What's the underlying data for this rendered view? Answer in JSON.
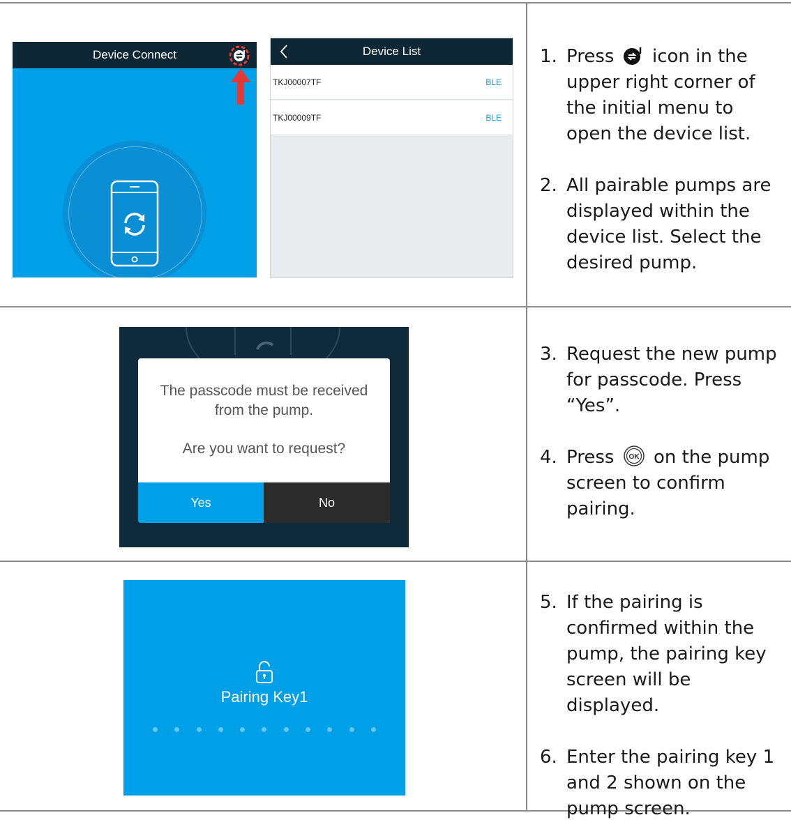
{
  "row1": {
    "connect_screen": {
      "title": "Device Connect"
    },
    "list_screen": {
      "title": "Device List",
      "devices": [
        {
          "name": "TKJ00007TF",
          "type": "BLE"
        },
        {
          "name": "TKJ00009TF",
          "type": "BLE"
        }
      ]
    },
    "steps": [
      {
        "num": "1.",
        "before_icon": "Press",
        "after_icon": "icon in the upper right corner of the initial menu to open the device list."
      },
      {
        "num": "2.",
        "text": "All pairable pumps are displayed within the device list.   Select the desired pump."
      }
    ]
  },
  "row2": {
    "dialog": {
      "message_line1": "The passcode must be received",
      "message_line2": "from the pump.",
      "question": "Are you want to request?",
      "yes_label": "Yes",
      "no_label": "No"
    },
    "steps": [
      {
        "num": "3.",
        "text": "Request the new pump for passcode. Press “Yes”."
      },
      {
        "num": "4.",
        "before_icon": "Press",
        "after_icon": "on the pump screen to confirm pairing."
      }
    ]
  },
  "row3": {
    "pair_screen": {
      "label": "Pairing Key1",
      "dot_count": 11
    },
    "steps": [
      {
        "num": "5.",
        "text": "If the pairing is confirmed within the pump, the pairing key screen will be displayed."
      },
      {
        "num": "6.",
        "text": "Enter the pairing key 1 and 2 shown on the pump screen."
      }
    ]
  },
  "icons": {
    "device_list_icon": "device-switch-icon",
    "ok_icon": "ok-button-icon",
    "lock": "unlock-icon",
    "sync": "sync-icon"
  },
  "colors": {
    "screen_blue": "#00a0e9",
    "topbar_navy": "#0e2735",
    "highlight_red": "#e53935"
  }
}
